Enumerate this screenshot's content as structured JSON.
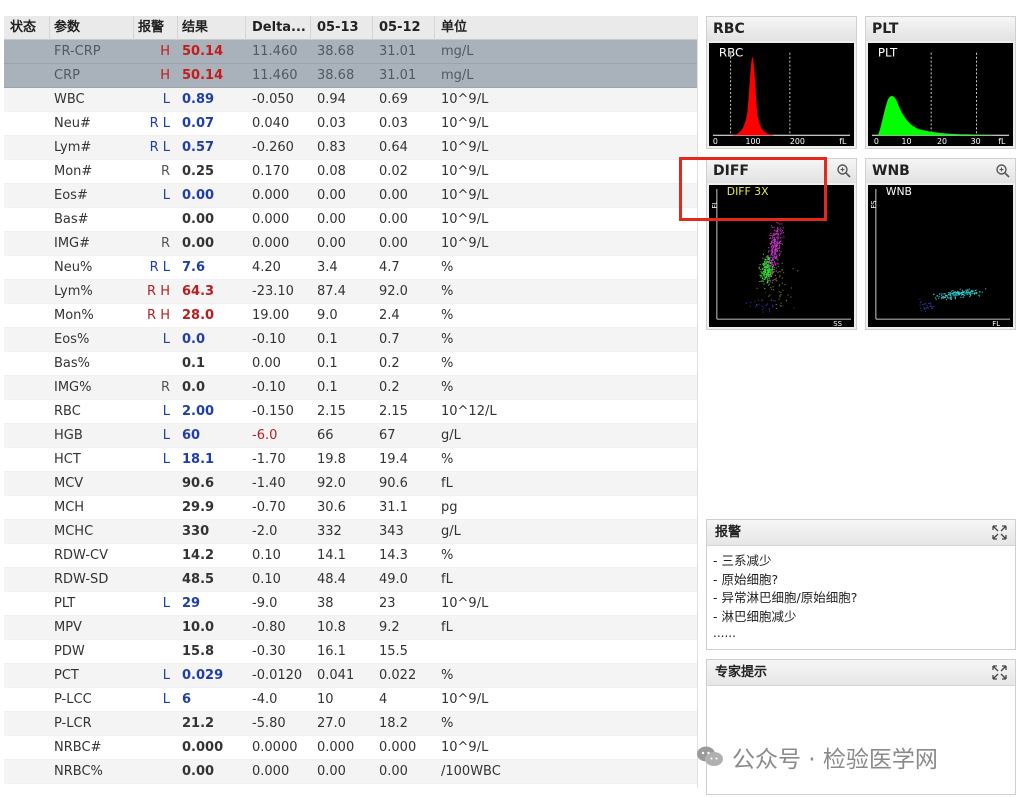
{
  "table": {
    "headers": {
      "status": "状态",
      "param": "参数",
      "flag": "报警",
      "result": "结果",
      "delta": "Delta...",
      "date1": "05-13",
      "date2": "05-12",
      "unit": "单位"
    },
    "rows": [
      {
        "param": "FR-CRP",
        "flag": "H",
        "result": "50.14",
        "delta": "11.460",
        "d1": "38.68",
        "d2": "31.01",
        "unit": "mg/L"
      },
      {
        "param": "CRP",
        "flag": "H",
        "result": "50.14",
        "delta": "11.460",
        "d1": "38.68",
        "d2": "31.01",
        "unit": "mg/L"
      },
      {
        "param": "WBC",
        "flag": "L",
        "result": "0.89",
        "delta": "-0.050",
        "d1": "0.94",
        "d2": "0.69",
        "unit": "10^9/L"
      },
      {
        "param": "Neu#",
        "flag": "R L",
        "result": "0.07",
        "delta": "0.040",
        "d1": "0.03",
        "d2": "0.03",
        "unit": "10^9/L"
      },
      {
        "param": "Lym#",
        "flag": "R L",
        "result": "0.57",
        "delta": "-0.260",
        "d1": "0.83",
        "d2": "0.64",
        "unit": "10^9/L"
      },
      {
        "param": "Mon#",
        "flag": "R",
        "result": "0.25",
        "delta": "0.170",
        "d1": "0.08",
        "d2": "0.02",
        "unit": "10^9/L"
      },
      {
        "param": "Eos#",
        "flag": "L",
        "result": "0.00",
        "delta": "0.000",
        "d1": "0.00",
        "d2": "0.00",
        "unit": "10^9/L"
      },
      {
        "param": "Bas#",
        "flag": "",
        "result": "0.00",
        "delta": "0.000",
        "d1": "0.00",
        "d2": "0.00",
        "unit": "10^9/L"
      },
      {
        "param": "IMG#",
        "flag": "R",
        "result": "0.00",
        "delta": "0.000",
        "d1": "0.00",
        "d2": "0.00",
        "unit": "10^9/L"
      },
      {
        "param": "Neu%",
        "flag": "R L",
        "result": "7.6",
        "delta": "4.20",
        "d1": "3.4",
        "d2": "4.7",
        "unit": "%"
      },
      {
        "param": "Lym%",
        "flag": "R H",
        "result": "64.3",
        "delta": "-23.10",
        "d1": "87.4",
        "d2": "92.0",
        "unit": "%"
      },
      {
        "param": "Mon%",
        "flag": "R H",
        "result": "28.0",
        "delta": "19.00",
        "d1": "9.0",
        "d2": "2.4",
        "unit": "%"
      },
      {
        "param": "Eos%",
        "flag": "L",
        "result": "0.0",
        "delta": "-0.10",
        "d1": "0.1",
        "d2": "0.7",
        "unit": "%"
      },
      {
        "param": "Bas%",
        "flag": "",
        "result": "0.1",
        "delta": "0.00",
        "d1": "0.1",
        "d2": "0.2",
        "unit": "%"
      },
      {
        "param": "IMG%",
        "flag": "R",
        "result": "0.0",
        "delta": "-0.10",
        "d1": "0.1",
        "d2": "0.2",
        "unit": "%"
      },
      {
        "param": "RBC",
        "flag": "L",
        "result": "2.00",
        "delta": "-0.150",
        "d1": "2.15",
        "d2": "2.15",
        "unit": "10^12/L"
      },
      {
        "param": "HGB",
        "flag": "L",
        "result": "60",
        "delta": "-6.0",
        "d1": "66",
        "d2": "67",
        "unit": "g/L"
      },
      {
        "param": "HCT",
        "flag": "L",
        "result": "18.1",
        "delta": "-1.70",
        "d1": "19.8",
        "d2": "19.4",
        "unit": "%"
      },
      {
        "param": "MCV",
        "flag": "",
        "result": "90.6",
        "delta": "-1.40",
        "d1": "92.0",
        "d2": "90.6",
        "unit": "fL"
      },
      {
        "param": "MCH",
        "flag": "",
        "result": "29.9",
        "delta": "-0.70",
        "d1": "30.6",
        "d2": "31.1",
        "unit": "pg"
      },
      {
        "param": "MCHC",
        "flag": "",
        "result": "330",
        "delta": "-2.0",
        "d1": "332",
        "d2": "343",
        "unit": "g/L"
      },
      {
        "param": "RDW-CV",
        "flag": "",
        "result": "14.2",
        "delta": "0.10",
        "d1": "14.1",
        "d2": "14.3",
        "unit": "%"
      },
      {
        "param": "RDW-SD",
        "flag": "",
        "result": "48.5",
        "delta": "0.10",
        "d1": "48.4",
        "d2": "49.0",
        "unit": "fL"
      },
      {
        "param": "PLT",
        "flag": "L",
        "result": "29",
        "delta": "-9.0",
        "d1": "38",
        "d2": "23",
        "unit": "10^9/L"
      },
      {
        "param": "MPV",
        "flag": "",
        "result": "10.0",
        "delta": "-0.80",
        "d1": "10.8",
        "d2": "9.2",
        "unit": "fL"
      },
      {
        "param": "PDW",
        "flag": "",
        "result": "15.8",
        "delta": "-0.30",
        "d1": "16.1",
        "d2": "15.5",
        "unit": ""
      },
      {
        "param": "PCT",
        "flag": "L",
        "result": "0.029",
        "delta": "-0.0120",
        "d1": "0.041",
        "d2": "0.022",
        "unit": "%"
      },
      {
        "param": "P-LCC",
        "flag": "L",
        "result": "6",
        "delta": "-4.0",
        "d1": "10",
        "d2": "4",
        "unit": "10^9/L"
      },
      {
        "param": "P-LCR",
        "flag": "",
        "result": "21.2",
        "delta": "-5.80",
        "d1": "27.0",
        "d2": "18.2",
        "unit": "%"
      },
      {
        "param": "NRBC#",
        "flag": "",
        "result": "0.000",
        "delta": "0.0000",
        "d1": "0.000",
        "d2": "0.000",
        "unit": "10^9/L"
      },
      {
        "param": "NRBC%",
        "flag": "",
        "result": "0.00",
        "delta": "0.000",
        "d1": "0.00",
        "d2": "0.00",
        "unit": "/100WBC"
      }
    ],
    "selected_rows": [
      0,
      1
    ]
  },
  "panels": {
    "rbc": {
      "title": "RBC",
      "inner_label": "RBC",
      "x_ticks": [
        "0",
        "100",
        "200",
        "fL"
      ],
      "color": "#ff0000"
    },
    "plt": {
      "title": "PLT",
      "inner_label": "PLT",
      "x_ticks": [
        "0",
        "10",
        "20",
        "30",
        "fL"
      ],
      "color": "#00ff00"
    },
    "diff": {
      "title": "DIFF",
      "inner_label": "DIFF 3X",
      "y_axis": "FL",
      "x_axis": "SS"
    },
    "wnb": {
      "title": "WNB",
      "inner_label": "WNB",
      "y_axis": "FS",
      "x_axis": "FL"
    }
  },
  "alarm": {
    "title": "报警",
    "items": [
      "三系减少",
      "原始细胞?",
      "异常淋巴细胞/原始细胞?",
      "淋巴细胞减少"
    ],
    "more": "......"
  },
  "expert": {
    "title": "专家提示"
  },
  "watermark": {
    "text": "公众号 · 检验医学网"
  },
  "colors": {
    "highlight": "#e4281c",
    "flag_high": "#b81e1e",
    "flag_low": "#1f3ea8"
  }
}
